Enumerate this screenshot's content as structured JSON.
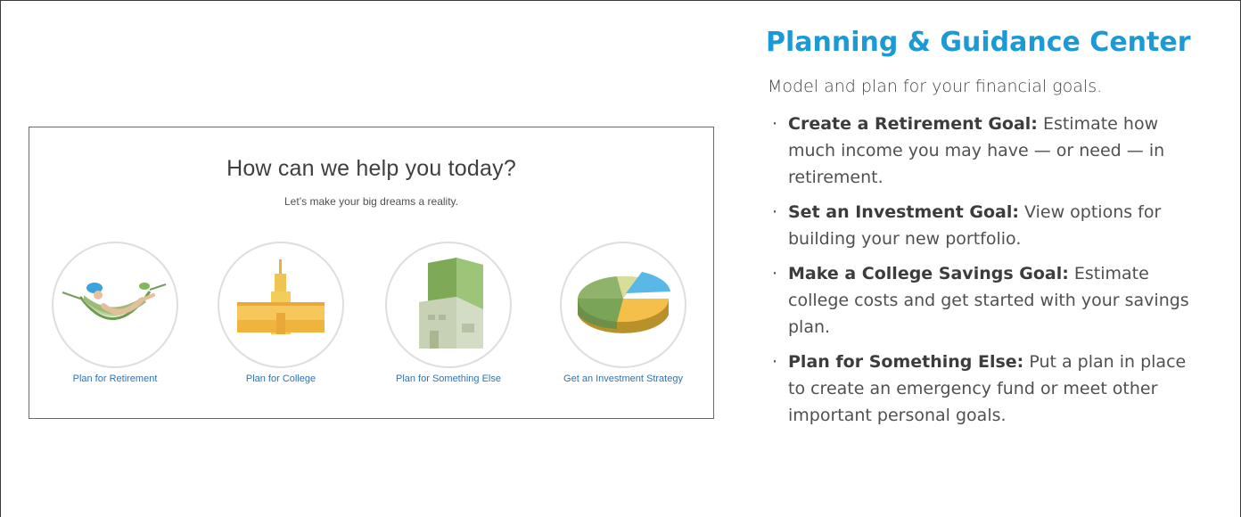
{
  "screenshot": {
    "heading": "How can we help you today?",
    "subheading": "Let’s make your big dreams a reality.",
    "options": [
      {
        "label": "Plan for Retirement",
        "icon": "hammock-icon"
      },
      {
        "label": "Plan for College",
        "icon": "college-building-icon"
      },
      {
        "label": "Plan for Something Else",
        "icon": "house-icon"
      },
      {
        "label": "Get an Investment Strategy",
        "icon": "pie-chart-icon"
      }
    ]
  },
  "panel": {
    "title": "Planning & Guidance Center",
    "intro": "Model and plan for your financial goals.",
    "items": [
      {
        "title": "Create a Retirement Goal:",
        "text": "Estimate how much income you may have — or need — in retirement."
      },
      {
        "title": "Set an Investment Goal:",
        "text": "View options for building your new portfolio."
      },
      {
        "title": "Make a College Savings Goal:",
        "text": "Estimate college costs and get started with your savings plan."
      },
      {
        "title": "Plan for Something Else:",
        "text": "Put a plan in place to create an emergency fund or meet other important personal goals."
      }
    ]
  },
  "colors": {
    "title_blue": "#1b9ad6",
    "link_blue": "#2f73b3",
    "circle_border": "#dedede"
  }
}
